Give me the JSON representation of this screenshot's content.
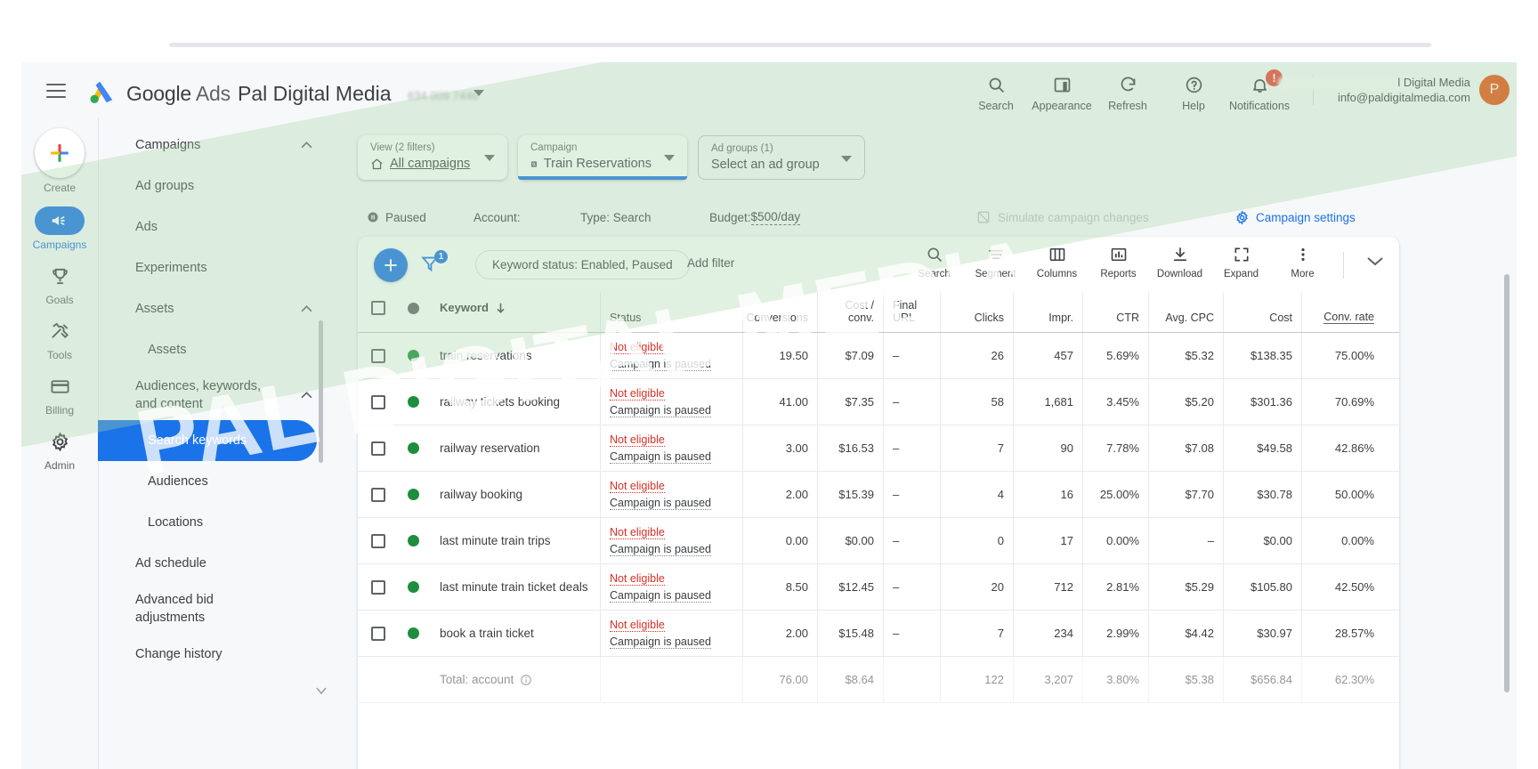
{
  "header": {
    "product_name_bold": "Google",
    "product_name_light": "Ads",
    "account_name": "Pal Digital Media",
    "account_id": "634 009 7446",
    "actions": [
      {
        "label": "Search",
        "icon": "search-icon"
      },
      {
        "label": "Appearance",
        "icon": "appearance-icon"
      },
      {
        "label": "Refresh",
        "icon": "refresh-icon"
      },
      {
        "label": "Help",
        "icon": "help-icon"
      },
      {
        "label": "Notifications",
        "icon": "bell-icon",
        "badge": "!"
      }
    ],
    "account_line1": "l Digital Media",
    "account_line2": "info@paldigitalmedia.com",
    "avatar_initial": "P"
  },
  "rail": {
    "items": [
      {
        "label": "Create",
        "icon": "plus-icon",
        "active": false
      },
      {
        "label": "Campaigns",
        "icon": "megaphone-icon",
        "active": true
      },
      {
        "label": "Goals",
        "icon": "trophy-icon",
        "active": false
      },
      {
        "label": "Tools",
        "icon": "tools-icon",
        "active": false
      },
      {
        "label": "Billing",
        "icon": "billing-card-icon",
        "active": false
      },
      {
        "label": "Admin",
        "icon": "gear-icon",
        "active": false
      }
    ]
  },
  "nav": {
    "items": [
      {
        "label": "Campaigns",
        "level": 0,
        "selected": false,
        "chevron": "up"
      },
      {
        "label": "Ad groups",
        "level": 1,
        "selected": false
      },
      {
        "label": "Ads",
        "level": 1,
        "selected": false
      },
      {
        "label": "Experiments",
        "level": 1,
        "selected": false
      },
      {
        "label": "Assets",
        "level": 0,
        "selected": false,
        "chevron": "up"
      },
      {
        "label": "Assets",
        "level": 2,
        "selected": false
      },
      {
        "label": "Audiences, keywords, and content",
        "level": 0,
        "selected": false,
        "chevron": "up",
        "wrap": true
      },
      {
        "label": "Search keywords",
        "level": 2,
        "selected": true
      },
      {
        "label": "Audiences",
        "level": 2,
        "selected": false
      },
      {
        "label": "Locations",
        "level": 2,
        "selected": false
      },
      {
        "label": "Ad schedule",
        "level": 1,
        "selected": false
      },
      {
        "label": "Advanced bid adjustments",
        "level": 1,
        "selected": false,
        "wrap": true
      },
      {
        "label": "Change history",
        "level": 0,
        "selected": false
      }
    ]
  },
  "filters": {
    "view": {
      "caption": "View (2 filters)",
      "value": "All campaigns",
      "icon": "home-icon"
    },
    "campaign": {
      "caption": "Campaign",
      "value": "Train Reservations",
      "icon": "search-square-icon"
    },
    "adgroups": {
      "caption": "Ad groups (1)",
      "value": "Select an ad group"
    }
  },
  "status_bar": {
    "state": "Paused",
    "account_label": "Account:",
    "type": "Type: Search",
    "budget_label": "Budget: ",
    "budget_value": "$500/day",
    "simulate": "Simulate campaign changes",
    "settings": "Campaign settings"
  },
  "toolbar": {
    "filter_badge": "1",
    "chip": "Keyword status: Enabled, Paused",
    "add_filter": "Add filter",
    "actions": [
      {
        "label": "Search",
        "icon": "search-icon"
      },
      {
        "label": "Segment",
        "icon": "segment-icon"
      },
      {
        "label": "Columns",
        "icon": "columns-icon"
      },
      {
        "label": "Reports",
        "icon": "reports-icon"
      },
      {
        "label": "Download",
        "icon": "download-icon"
      },
      {
        "label": "Expand",
        "icon": "expand-icon"
      },
      {
        "label": "More",
        "icon": "more-vert-icon"
      }
    ]
  },
  "table": {
    "columns": [
      {
        "key": "keyword",
        "label": "Keyword",
        "sort": "down"
      },
      {
        "key": "status",
        "label": "Status"
      },
      {
        "key": "conversions",
        "label": "Conversions"
      },
      {
        "key": "cost_conv_l1",
        "label": "Cost /",
        "label2": "conv."
      },
      {
        "key": "final_url_l1",
        "label": "Final",
        "label2": "URL"
      },
      {
        "key": "clicks",
        "label": "Clicks"
      },
      {
        "key": "impr",
        "label": "Impr."
      },
      {
        "key": "ctr",
        "label": "CTR"
      },
      {
        "key": "avg_cpc",
        "label": "Avg. CPC"
      },
      {
        "key": "cost",
        "label": "Cost"
      },
      {
        "key": "conv_rate",
        "label": "Conv. rate"
      }
    ],
    "status_texts": {
      "not_eligible": "Not eligible",
      "campaign_paused": "Campaign is paused"
    },
    "rows": [
      {
        "keyword": "train reservations",
        "conversions": "19.50",
        "cost_conv": "$7.09",
        "final_url": "–",
        "clicks": "26",
        "impr": "457",
        "ctr": "5.69%",
        "avg_cpc": "$5.32",
        "cost": "$138.35",
        "conv_rate": "75.00%"
      },
      {
        "keyword": "railway tickets booking",
        "conversions": "41.00",
        "cost_conv": "$7.35",
        "final_url": "–",
        "clicks": "58",
        "impr": "1,681",
        "ctr": "3.45%",
        "avg_cpc": "$5.20",
        "cost": "$301.36",
        "conv_rate": "70.69%"
      },
      {
        "keyword": "railway reservation",
        "conversions": "3.00",
        "cost_conv": "$16.53",
        "final_url": "–",
        "clicks": "7",
        "impr": "90",
        "ctr": "7.78%",
        "avg_cpc": "$7.08",
        "cost": "$49.58",
        "conv_rate": "42.86%"
      },
      {
        "keyword": "railway booking",
        "conversions": "2.00",
        "cost_conv": "$15.39",
        "final_url": "–",
        "clicks": "4",
        "impr": "16",
        "ctr": "25.00%",
        "avg_cpc": "$7.70",
        "cost": "$30.78",
        "conv_rate": "50.00%"
      },
      {
        "keyword": "last minute train trips",
        "conversions": "0.00",
        "cost_conv": "$0.00",
        "final_url": "–",
        "clicks": "0",
        "impr": "17",
        "ctr": "0.00%",
        "avg_cpc": "–",
        "cost": "$0.00",
        "conv_rate": "0.00%"
      },
      {
        "keyword": "last minute train ticket deals",
        "conversions": "8.50",
        "cost_conv": "$12.45",
        "final_url": "–",
        "clicks": "20",
        "impr": "712",
        "ctr": "2.81%",
        "avg_cpc": "$5.29",
        "cost": "$105.80",
        "conv_rate": "42.50%"
      },
      {
        "keyword": "book a train ticket",
        "conversions": "2.00",
        "cost_conv": "$15.48",
        "final_url": "–",
        "clicks": "7",
        "impr": "234",
        "ctr": "2.99%",
        "avg_cpc": "$4.42",
        "cost": "$30.97",
        "conv_rate": "28.57%"
      }
    ],
    "total_row": {
      "keyword": "Total: account",
      "conversions": "76.00",
      "cost_conv": "$8.64",
      "final_url": "",
      "clicks": "122",
      "impr": "3,207",
      "ctr": "3.80%",
      "avg_cpc": "$5.38",
      "cost": "$656.84",
      "conv_rate": "62.30%"
    }
  },
  "watermark": {
    "text": "PAL DIGITAL MEDIA"
  },
  "colors": {
    "accent_blue": "#1a73e8",
    "danger_red": "#d93025",
    "success_green": "#1e8e3e",
    "avatar_orange": "#e8500e"
  }
}
